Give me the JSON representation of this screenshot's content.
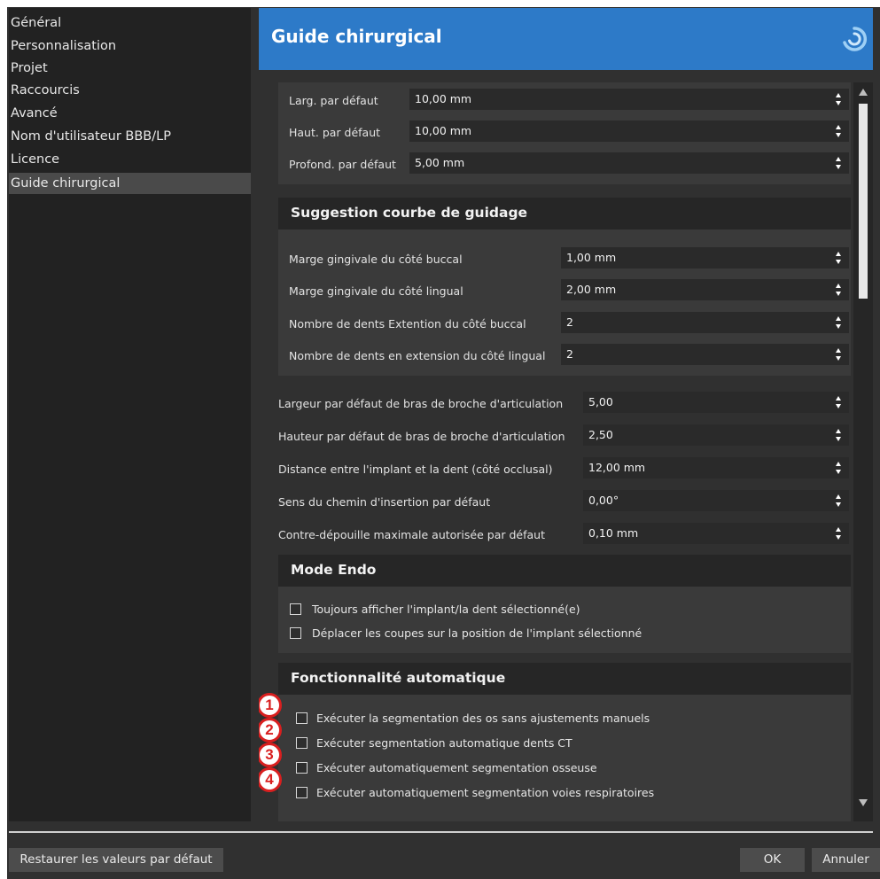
{
  "sidebar": {
    "items": [
      {
        "label": "Général"
      },
      {
        "label": "Personnalisation"
      },
      {
        "label": "Projet"
      },
      {
        "label": "Raccourcis"
      },
      {
        "label": "Avancé"
      },
      {
        "label": "Nom d'utilisateur BBB/LP"
      },
      {
        "label": "Licence"
      },
      {
        "label": "Guide chirurgical",
        "selected": true
      }
    ]
  },
  "header": {
    "title": "Guide chirurgical",
    "logo_icon": "swirl-logo-icon"
  },
  "defaults_group": {
    "fields": [
      {
        "label": "Larg. par défaut",
        "value": "10,00 mm"
      },
      {
        "label": "Haut. par défaut",
        "value": "10,00 mm"
      },
      {
        "label": "Profond. par défaut",
        "value": "5,00 mm"
      }
    ]
  },
  "curve_group": {
    "title": "Suggestion courbe de guidage",
    "fields": [
      {
        "label": "Marge gingivale du côté buccal",
        "value": "1,00 mm"
      },
      {
        "label": "Marge gingivale du côté lingual",
        "value": "2,00 mm"
      },
      {
        "label": "Nombre de dents Extention du côté buccal",
        "value": "2"
      },
      {
        "label": "Nombre de dents en extension du côté lingual",
        "value": "2"
      }
    ]
  },
  "general_fields": [
    {
      "label": "Largeur par défaut de bras de broche d'articulation",
      "value": "5,00"
    },
    {
      "label": "Hauteur par défaut de bras de broche d'articulation",
      "value": "2,50"
    },
    {
      "label": "Distance entre l'implant et la dent (côté occlusal)",
      "value": "12,00 mm"
    },
    {
      "label": "Sens du chemin d'insertion par défaut",
      "value": "0,00°"
    },
    {
      "label": "Contre-dépouille maximale autorisée par défaut",
      "value": "0,10 mm"
    }
  ],
  "endo_group": {
    "title": "Mode Endo",
    "checkboxes": [
      {
        "label": "Toujours afficher l'implant/la dent sélectionné(e)",
        "checked": false
      },
      {
        "label": "Déplacer les coupes sur la position de l'implant sélectionné",
        "checked": false
      }
    ]
  },
  "auto_group": {
    "title": "Fonctionnalité automatique",
    "checkboxes": [
      {
        "badge": "1",
        "label": "Exécuter la segmentation des os sans ajustements manuels",
        "checked": false
      },
      {
        "badge": "2",
        "label": "Exécuter segmentation automatique dents CT",
        "checked": false
      },
      {
        "badge": "3",
        "label": "Exécuter automatiquement segmentation osseuse",
        "checked": false
      },
      {
        "badge": "4",
        "label": "Exécuter automatiquement segmentation voies respiratoires",
        "checked": false
      }
    ]
  },
  "footer": {
    "restore_label": "Restaurer les valeurs par défaut",
    "ok_label": "OK",
    "cancel_label": "Annuler"
  },
  "colors": {
    "header_blue": "#2d7ac8",
    "badge_red": "#d91f1f",
    "background": "#303030"
  }
}
